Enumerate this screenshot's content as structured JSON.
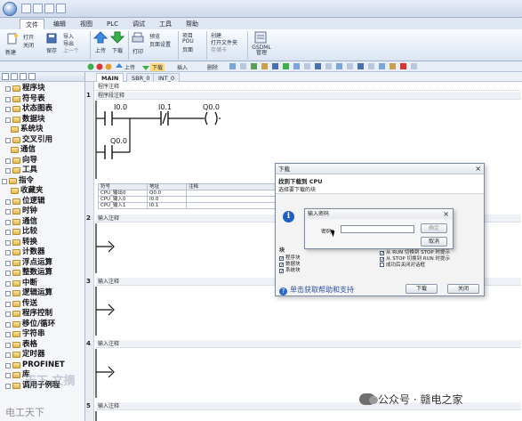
{
  "menu": {
    "tabs": [
      "文件",
      "编辑",
      "视图",
      "PLC",
      "调试",
      "工具",
      "帮助"
    ],
    "active_index": 0
  },
  "ribbon": {
    "new_label": "新建",
    "open_label": "打开",
    "close_label": "关闭",
    "save_label": "保存",
    "import_label": "导入",
    "export_label": "导出",
    "previous_label": "上一个",
    "upload_label": "上传",
    "download_label": "下载",
    "print_label": "打印",
    "preview_label": "预览",
    "page_setup_label": "页面设置",
    "project_label": "项目",
    "pou_label": "POU",
    "page_label": "页面",
    "create_label": "创建",
    "open_folder_label": "打开文件夹",
    "library_label": "存储卡",
    "gsdml_label": "GSDML\n管理"
  },
  "toolbar": {
    "upload_label": "上传",
    "download_label": "下载",
    "insert_label": "插入",
    "delete_label": "删除"
  },
  "tree": {
    "items": [
      {
        "label": "程序块",
        "indent": 0
      },
      {
        "label": "符号表",
        "indent": 0
      },
      {
        "label": "状态图表",
        "indent": 0
      },
      {
        "label": "数据块",
        "indent": 0
      },
      {
        "label": "系统块",
        "indent": 1
      },
      {
        "label": "交叉引用",
        "indent": 0
      },
      {
        "label": "通信",
        "indent": 1
      },
      {
        "label": "向导",
        "indent": 0
      },
      {
        "label": "工具",
        "indent": 0
      },
      {
        "label": "指令",
        "indent": -1
      },
      {
        "label": "收藏夹",
        "indent": 1
      },
      {
        "label": "位逻辑",
        "indent": 0
      },
      {
        "label": "时钟",
        "indent": 0
      },
      {
        "label": "通信",
        "indent": 0
      },
      {
        "label": "比较",
        "indent": 0
      },
      {
        "label": "转换",
        "indent": 0
      },
      {
        "label": "计数器",
        "indent": 0
      },
      {
        "label": "浮点运算",
        "indent": 0
      },
      {
        "label": "整数运算",
        "indent": 0
      },
      {
        "label": "中断",
        "indent": 0
      },
      {
        "label": "逻辑运算",
        "indent": 0
      },
      {
        "label": "传送",
        "indent": 0
      },
      {
        "label": "程序控制",
        "indent": 0
      },
      {
        "label": "移位/循环",
        "indent": 0
      },
      {
        "label": "字符串",
        "indent": 0
      },
      {
        "label": "表格",
        "indent": 0
      },
      {
        "label": "定时器",
        "indent": 0
      },
      {
        "label": "PROFINET",
        "indent": 0
      },
      {
        "label": "库",
        "indent": 0
      },
      {
        "label": "调用子例程",
        "indent": 0
      }
    ]
  },
  "editor": {
    "tabs": [
      "MAIN",
      "SBR_0",
      "INT_0"
    ],
    "active_tab": 0,
    "program_comment": "程序注释",
    "networks": [
      {
        "num": "1",
        "comment": "程序段注释"
      },
      {
        "num": "2",
        "comment": "输入注释"
      },
      {
        "num": "3",
        "comment": "输入注释"
      },
      {
        "num": "4",
        "comment": "输入注释"
      },
      {
        "num": "5",
        "comment": "输入注释"
      }
    ],
    "contacts": {
      "i00": "I0.0",
      "i01": "I0.1",
      "q00_coil": "Q0.0",
      "q00_contact": "Q0.0"
    },
    "symbol_table": {
      "headers": [
        "符号",
        "地址",
        "注释"
      ],
      "rows": [
        [
          "CPU_输出0",
          "Q0.0",
          ""
        ],
        [
          "CPU_输入0",
          "I0.0",
          ""
        ],
        [
          "CPU_输入1",
          "I0.1",
          ""
        ]
      ]
    }
  },
  "download_dialog": {
    "title": "下载",
    "header_bold": "找到下载到 CPU",
    "header_sub": "选择要下载的块",
    "blocks_label": "块",
    "left_checks": [
      "程序块",
      "数据块",
      "系统块"
    ],
    "right_checks": [
      "从 RUN 切换到 STOP 时提示",
      "从 STOP 切换到 RUN 时提示",
      "成功后关闭对话框"
    ],
    "help_text": "单击获取帮助和支持",
    "download_btn": "下载",
    "close_btn": "关闭"
  },
  "password_dialog": {
    "title": "输入密码",
    "password_label": "密码：",
    "ok_btn": "确定",
    "cancel_btn": "取消",
    "close_glyph": "×"
  },
  "watermarks": {
    "wechat": "公众号 · 赣电之家",
    "bottom_left": "电工天下",
    "center": "天下 文摘"
  },
  "colors": {
    "ribbon_blue": "#dbe5f2",
    "info_blue": "#1f5fc2",
    "help_blue": "#2f53a8"
  }
}
